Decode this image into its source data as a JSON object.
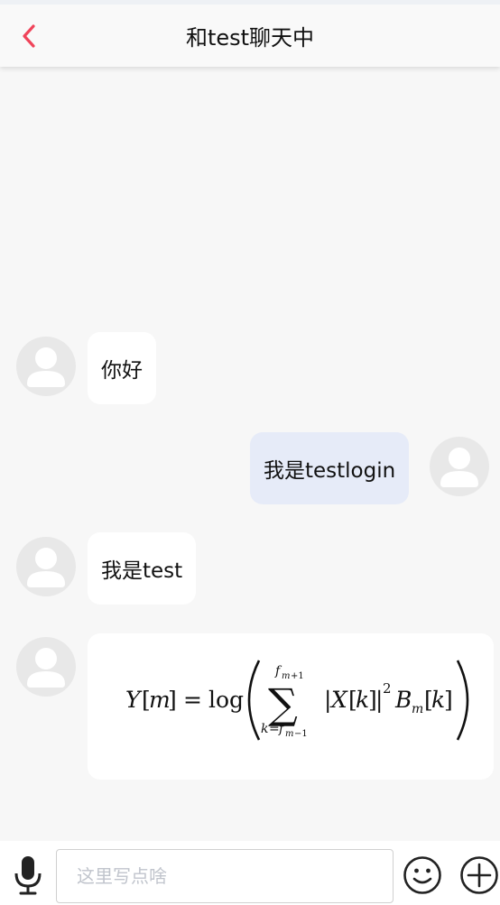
{
  "header": {
    "title": "和test聊天中",
    "back_icon": "chevron-left-icon",
    "accent_color": "#f0445a"
  },
  "messages": [
    {
      "side": "left",
      "text": "你好",
      "avatar_icon": "user-avatar-icon"
    },
    {
      "side": "right",
      "text": "我是testlogin",
      "avatar_icon": "user-avatar-icon"
    },
    {
      "side": "left",
      "text": "我是test",
      "avatar_icon": "user-avatar-icon"
    },
    {
      "side": "left",
      "type": "formula",
      "formula": "Y[m] = log( Σ_{k=f_{m-1}}^{f_{m+1}} |X[k]|² B_m[k] )",
      "avatar_icon": "user-avatar-icon"
    }
  ],
  "input_bar": {
    "placeholder": "这里写点啥",
    "value": "",
    "mic_icon": "microphone-icon",
    "emoji_icon": "smile-emoji-icon",
    "plus_icon": "plus-circle-icon"
  },
  "colors": {
    "page_bg": "#f7f7f7",
    "bubble_left": "#ffffff",
    "bubble_right": "#e6ebf8",
    "avatar_bg": "#e8e8e8"
  }
}
